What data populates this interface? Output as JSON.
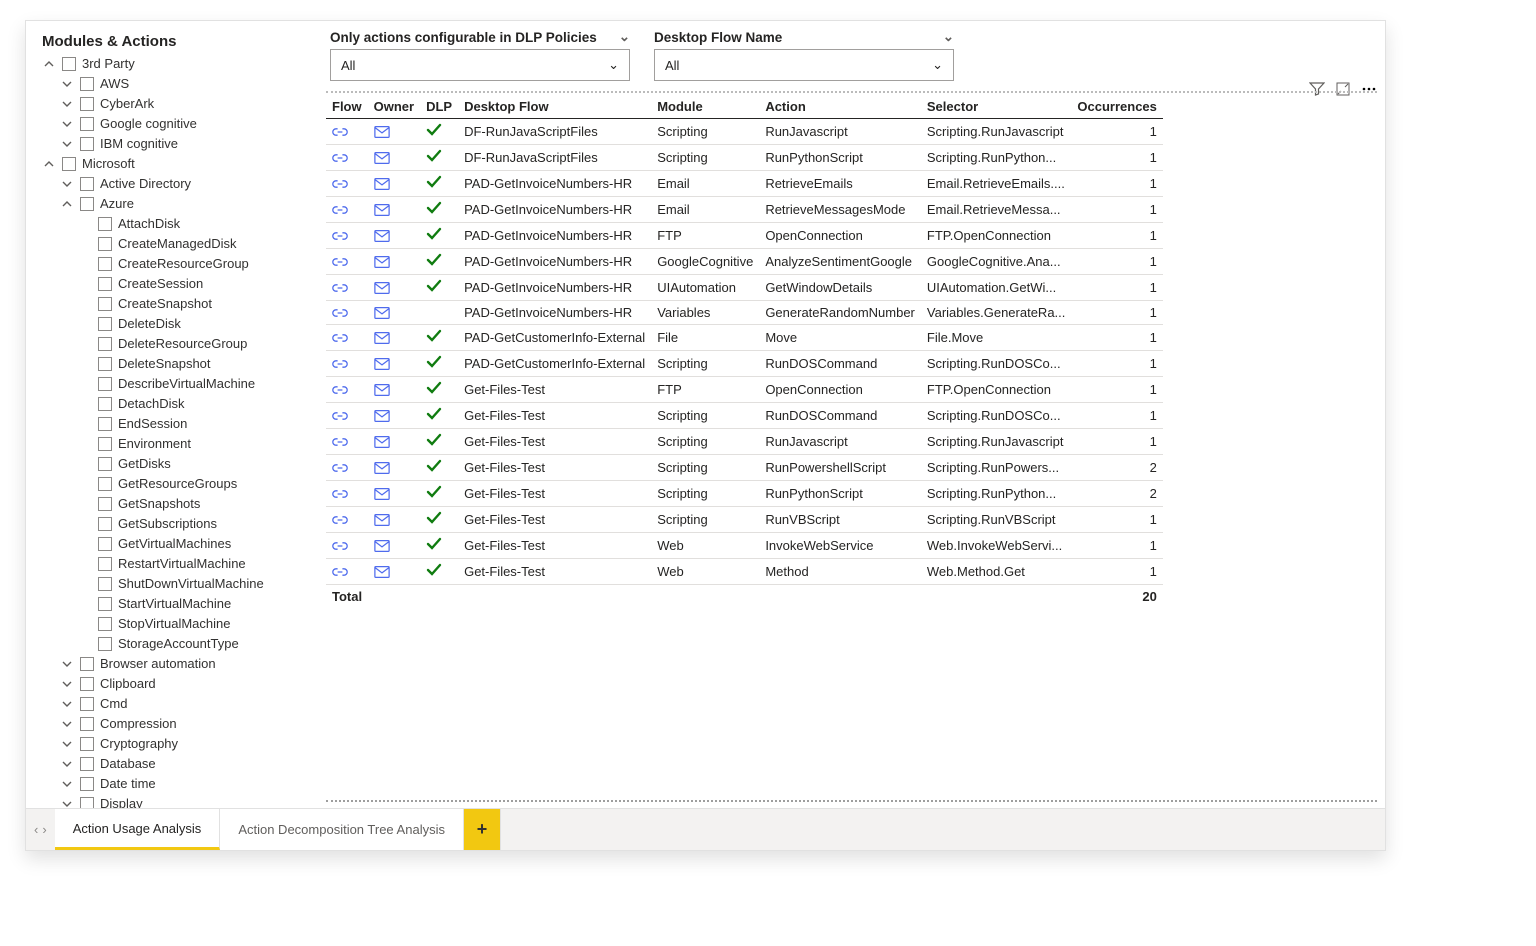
{
  "sidebar": {
    "title": "Modules & Actions",
    "items": [
      {
        "level": 0,
        "label": "3rd Party",
        "chev": "up",
        "checkbox": true
      },
      {
        "level": 1,
        "label": "AWS",
        "chev": "down",
        "checkbox": true
      },
      {
        "level": 1,
        "label": "CyberArk",
        "chev": "down",
        "checkbox": true
      },
      {
        "level": 1,
        "label": "Google cognitive",
        "chev": "down",
        "checkbox": true
      },
      {
        "level": 1,
        "label": "IBM cognitive",
        "chev": "down",
        "checkbox": true
      },
      {
        "level": 0,
        "label": "Microsoft",
        "chev": "up",
        "checkbox": true
      },
      {
        "level": 1,
        "label": "Active Directory",
        "chev": "down",
        "checkbox": true
      },
      {
        "level": 1,
        "label": "Azure",
        "chev": "up",
        "checkbox": true
      },
      {
        "level": 2,
        "label": "AttachDisk",
        "chev": "",
        "checkbox": true
      },
      {
        "level": 2,
        "label": "CreateManagedDisk",
        "chev": "",
        "checkbox": true
      },
      {
        "level": 2,
        "label": "CreateResourceGroup",
        "chev": "",
        "checkbox": true
      },
      {
        "level": 2,
        "label": "CreateSession",
        "chev": "",
        "checkbox": true
      },
      {
        "level": 2,
        "label": "CreateSnapshot",
        "chev": "",
        "checkbox": true
      },
      {
        "level": 2,
        "label": "DeleteDisk",
        "chev": "",
        "checkbox": true
      },
      {
        "level": 2,
        "label": "DeleteResourceGroup",
        "chev": "",
        "checkbox": true
      },
      {
        "level": 2,
        "label": "DeleteSnapshot",
        "chev": "",
        "checkbox": true
      },
      {
        "level": 2,
        "label": "DescribeVirtualMachine",
        "chev": "",
        "checkbox": true
      },
      {
        "level": 2,
        "label": "DetachDisk",
        "chev": "",
        "checkbox": true
      },
      {
        "level": 2,
        "label": "EndSession",
        "chev": "",
        "checkbox": true
      },
      {
        "level": 2,
        "label": "Environment",
        "chev": "",
        "checkbox": true
      },
      {
        "level": 2,
        "label": "GetDisks",
        "chev": "",
        "checkbox": true
      },
      {
        "level": 2,
        "label": "GetResourceGroups",
        "chev": "",
        "checkbox": true
      },
      {
        "level": 2,
        "label": "GetSnapshots",
        "chev": "",
        "checkbox": true
      },
      {
        "level": 2,
        "label": "GetSubscriptions",
        "chev": "",
        "checkbox": true
      },
      {
        "level": 2,
        "label": "GetVirtualMachines",
        "chev": "",
        "checkbox": true
      },
      {
        "level": 2,
        "label": "RestartVirtualMachine",
        "chev": "",
        "checkbox": true
      },
      {
        "level": 2,
        "label": "ShutDownVirtualMachine",
        "chev": "",
        "checkbox": true
      },
      {
        "level": 2,
        "label": "StartVirtualMachine",
        "chev": "",
        "checkbox": true
      },
      {
        "level": 2,
        "label": "StopVirtualMachine",
        "chev": "",
        "checkbox": true
      },
      {
        "level": 2,
        "label": "StorageAccountType",
        "chev": "",
        "checkbox": true
      },
      {
        "level": 1,
        "label": "Browser automation",
        "chev": "down",
        "checkbox": true
      },
      {
        "level": 1,
        "label": "Clipboard",
        "chev": "down",
        "checkbox": true
      },
      {
        "level": 1,
        "label": "Cmd",
        "chev": "down",
        "checkbox": true
      },
      {
        "level": 1,
        "label": "Compression",
        "chev": "down",
        "checkbox": true
      },
      {
        "level": 1,
        "label": "Cryptography",
        "chev": "down",
        "checkbox": true
      },
      {
        "level": 1,
        "label": "Database",
        "chev": "down",
        "checkbox": true
      },
      {
        "level": 1,
        "label": "Date time",
        "chev": "down",
        "checkbox": true
      },
      {
        "level": 1,
        "label": "Display",
        "chev": "down",
        "checkbox": true
      }
    ]
  },
  "slicers": {
    "dlp": {
      "title": "Only actions configurable in DLP Policies",
      "value": "All"
    },
    "flow": {
      "title": "Desktop Flow Name",
      "value": "All"
    }
  },
  "table": {
    "headers": {
      "flow": "Flow",
      "owner": "Owner",
      "dlp": "DLP",
      "desktop": "Desktop Flow",
      "module": "Module",
      "action": "Action",
      "selector": "Selector",
      "occ": "Occurrences"
    },
    "rows": [
      {
        "dlp": true,
        "name": "DF-RunJavaScriptFiles",
        "module": "Scripting",
        "action": "RunJavascript",
        "selector": "Scripting.RunJavascript",
        "occ": 1
      },
      {
        "dlp": true,
        "name": "DF-RunJavaScriptFiles",
        "module": "Scripting",
        "action": "RunPythonScript",
        "selector": "Scripting.RunPython...",
        "occ": 1
      },
      {
        "dlp": true,
        "name": "PAD-GetInvoiceNumbers-HR",
        "module": "Email",
        "action": "RetrieveEmails",
        "selector": "Email.RetrieveEmails....",
        "occ": 1
      },
      {
        "dlp": true,
        "name": "PAD-GetInvoiceNumbers-HR",
        "module": "Email",
        "action": "RetrieveMessagesMode",
        "selector": "Email.RetrieveMessa...",
        "occ": 1
      },
      {
        "dlp": true,
        "name": "PAD-GetInvoiceNumbers-HR",
        "module": "FTP",
        "action": "OpenConnection",
        "selector": "FTP.OpenConnection",
        "occ": 1
      },
      {
        "dlp": true,
        "name": "PAD-GetInvoiceNumbers-HR",
        "module": "GoogleCognitive",
        "action": "AnalyzeSentimentGoogle",
        "selector": "GoogleCognitive.Ana...",
        "occ": 1
      },
      {
        "dlp": true,
        "name": "PAD-GetInvoiceNumbers-HR",
        "module": "UIAutomation",
        "action": "GetWindowDetails",
        "selector": "UIAutomation.GetWi...",
        "occ": 1
      },
      {
        "dlp": false,
        "name": "PAD-GetInvoiceNumbers-HR",
        "module": "Variables",
        "action": "GenerateRandomNumber",
        "selector": "Variables.GenerateRa...",
        "occ": 1
      },
      {
        "dlp": true,
        "name": "PAD-GetCustomerInfo-External",
        "module": "File",
        "action": "Move",
        "selector": "File.Move",
        "occ": 1
      },
      {
        "dlp": true,
        "name": "PAD-GetCustomerInfo-External",
        "module": "Scripting",
        "action": "RunDOSCommand",
        "selector": "Scripting.RunDOSCo...",
        "occ": 1
      },
      {
        "dlp": true,
        "name": "Get-Files-Test",
        "module": "FTP",
        "action": "OpenConnection",
        "selector": "FTP.OpenConnection",
        "occ": 1
      },
      {
        "dlp": true,
        "name": "Get-Files-Test",
        "module": "Scripting",
        "action": "RunDOSCommand",
        "selector": "Scripting.RunDOSCo...",
        "occ": 1
      },
      {
        "dlp": true,
        "name": "Get-Files-Test",
        "module": "Scripting",
        "action": "RunJavascript",
        "selector": "Scripting.RunJavascript",
        "occ": 1
      },
      {
        "dlp": true,
        "name": "Get-Files-Test",
        "module": "Scripting",
        "action": "RunPowershellScript",
        "selector": "Scripting.RunPowers...",
        "occ": 2
      },
      {
        "dlp": true,
        "name": "Get-Files-Test",
        "module": "Scripting",
        "action": "RunPythonScript",
        "selector": "Scripting.RunPython...",
        "occ": 2
      },
      {
        "dlp": true,
        "name": "Get-Files-Test",
        "module": "Scripting",
        "action": "RunVBScript",
        "selector": "Scripting.RunVBScript",
        "occ": 1
      },
      {
        "dlp": true,
        "name": "Get-Files-Test",
        "module": "Web",
        "action": "InvokeWebService",
        "selector": "Web.InvokeWebServi...",
        "occ": 1
      },
      {
        "dlp": true,
        "name": "Get-Files-Test",
        "module": "Web",
        "action": "Method",
        "selector": "Web.Method.Get",
        "occ": 1
      }
    ],
    "total_label": "Total",
    "total_value": "20"
  },
  "tabs": {
    "active": "Action Usage Analysis",
    "inactive": "Action Decomposition Tree Analysis"
  }
}
